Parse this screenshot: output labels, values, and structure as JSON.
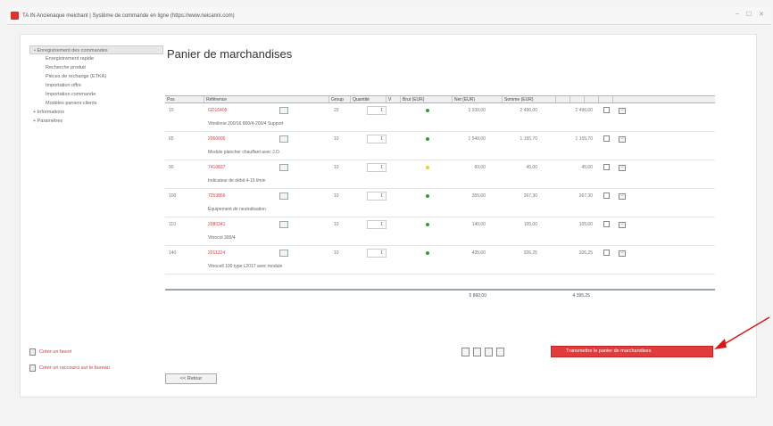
{
  "window": {
    "title": "TA IN Ancienaque meichant | Système de commande en ligne (https://www.neicanni.com)",
    "controls": [
      "–",
      "☐",
      "✕"
    ]
  },
  "sidebar": {
    "items": [
      {
        "label": "• Enregistrement des commandes",
        "active": true
      },
      {
        "label": "Enregistrement rapide",
        "sub": true
      },
      {
        "label": "Recherche produit",
        "sub": true
      },
      {
        "label": "Pièces de rechange (ETKA)",
        "sub": true
      },
      {
        "label": "Importation offre",
        "sub": true
      },
      {
        "label": "Importation commande",
        "sub": true
      },
      {
        "label": "Modèles paniers clients",
        "sub": true
      },
      {
        "label": "+ Informations"
      },
      {
        "label": "+ Paramètres"
      }
    ],
    "footer_links": [
      {
        "label": "Créer un favori",
        "icon": "favorite-icon"
      },
      {
        "label": "Créer un raccourci sur le bureau",
        "icon": "shortcut-icon"
      }
    ]
  },
  "main": {
    "title": "Panier de marchandises",
    "columns": [
      "Pos",
      "Référence",
      "Group",
      "Quantité",
      "V",
      "Brut (EUR)",
      "Net (EUR)",
      "Somme (EUR)",
      "",
      "",
      "",
      ""
    ],
    "rows": [
      {
        "pos": "10",
        "ref": "GD16405",
        "desc": "Vitrolinne 200/16 800/4-200/4 Support",
        "group": "20",
        "qty": "1",
        "status": "green",
        "brut": "3 330,00",
        "net": "2 496,00",
        "sum": "2 496,00"
      },
      {
        "pos": "65",
        "ref": "2060000",
        "desc": "Module plancher chauffant avec J.D.",
        "group": "10",
        "qty": "1",
        "status": "green",
        "brut": "1 540,00",
        "net": "1 155,70",
        "sum": "1 155,70"
      },
      {
        "pos": "90",
        "ref": "7410837",
        "desc": "Indicateur de débit 4-15 l/min",
        "group": "10",
        "qty": "1",
        "status": "yellow",
        "brut": "60,00",
        "net": "45,00",
        "sum": "45,00"
      },
      {
        "pos": "100",
        "ref": "7253866",
        "desc": "Équipement de neutralisation",
        "group": "10",
        "qty": "1",
        "status": "green",
        "brut": "355,00",
        "net": "267,30",
        "sum": "267,30"
      },
      {
        "pos": "110",
        "ref": "2080341",
        "desc": "Vitrocol 300/4",
        "group": "10",
        "qty": "1",
        "status": "green",
        "brut": "140,00",
        "net": "105,00",
        "sum": "105,00"
      },
      {
        "pos": "140",
        "ref": "2011224",
        "desc": "Vitrocell 100 type L2017 avec module",
        "group": "10",
        "qty": "1",
        "status": "green",
        "brut": "435,00",
        "net": "326,25",
        "sum": "326,25"
      }
    ],
    "totals": {
      "brut": "5 860,00",
      "sum": "4 395,25"
    },
    "transfer_button": "Transmettre le panier de marchandises",
    "back_button": "<< Retour"
  },
  "colors": {
    "accent": "#e23b3b",
    "status_green": "#2e9e3e",
    "status_yellow": "#e8d22a",
    "arrow": "#d81818"
  }
}
